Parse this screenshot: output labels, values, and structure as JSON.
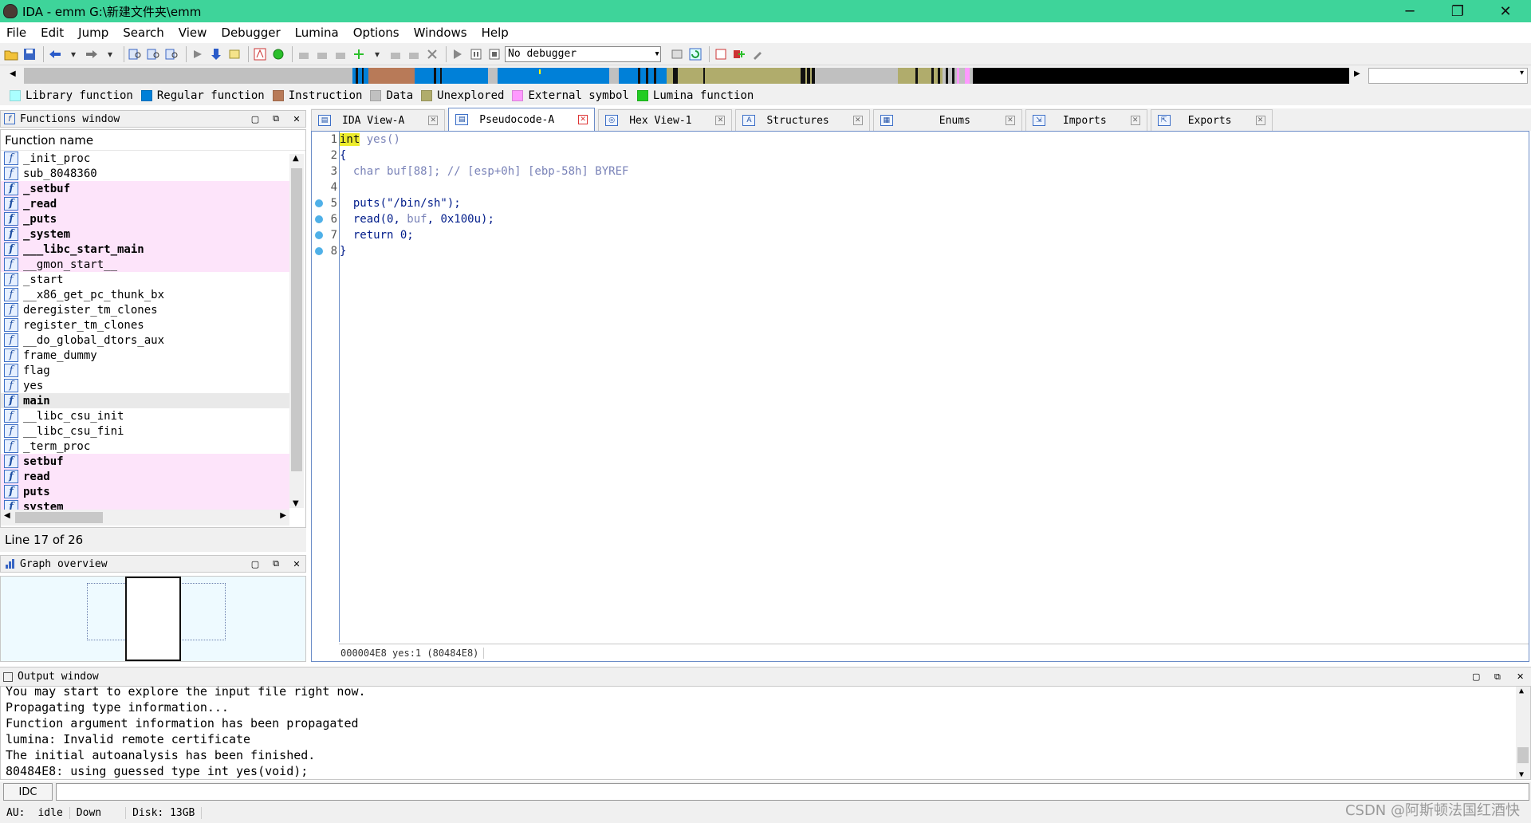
{
  "window": {
    "title": "IDA - emm G:\\新建文件夹\\emm",
    "controls": [
      "─",
      "❐",
      "✕"
    ]
  },
  "menu": [
    "File",
    "Edit",
    "Jump",
    "Search",
    "View",
    "Debugger",
    "Lumina",
    "Options",
    "Windows",
    "Help"
  ],
  "toolbar": {
    "debugger_select": "No debugger"
  },
  "legend": [
    {
      "label": "Library function",
      "color": "#aaffff"
    },
    {
      "label": "Regular function",
      "color": "#0080d8"
    },
    {
      "label": "Instruction",
      "color": "#b87a58"
    },
    {
      "label": "Data",
      "color": "#c0c0c0"
    },
    {
      "label": "Unexplored",
      "color": "#b0ac6c"
    },
    {
      "label": "External symbol",
      "color": "#ff99ff"
    },
    {
      "label": "Lumina function",
      "color": "#22cc22"
    }
  ],
  "functions_window": {
    "title": "Functions window",
    "column_header": "Function name",
    "items": [
      {
        "name": "_init_proc",
        "style": ""
      },
      {
        "name": "sub_8048360",
        "style": ""
      },
      {
        "name": "_setbuf",
        "style": "lib bold"
      },
      {
        "name": "_read",
        "style": "lib bold"
      },
      {
        "name": "_puts",
        "style": "lib bold"
      },
      {
        "name": "_system",
        "style": "lib bold"
      },
      {
        "name": "___libc_start_main",
        "style": "lib bold"
      },
      {
        "name": "__gmon_start__",
        "style": "lib"
      },
      {
        "name": "_start",
        "style": ""
      },
      {
        "name": "__x86_get_pc_thunk_bx",
        "style": ""
      },
      {
        "name": "deregister_tm_clones",
        "style": ""
      },
      {
        "name": "register_tm_clones",
        "style": ""
      },
      {
        "name": "__do_global_dtors_aux",
        "style": ""
      },
      {
        "name": "frame_dummy",
        "style": ""
      },
      {
        "name": "flag",
        "style": ""
      },
      {
        "name": "yes",
        "style": ""
      },
      {
        "name": "main",
        "style": "sel bold"
      },
      {
        "name": "__libc_csu_init",
        "style": ""
      },
      {
        "name": "__libc_csu_fini",
        "style": ""
      },
      {
        "name": "_term_proc",
        "style": ""
      },
      {
        "name": "setbuf",
        "style": "lib bold"
      },
      {
        "name": "read",
        "style": "lib bold"
      },
      {
        "name": "puts",
        "style": "lib bold"
      },
      {
        "name": "system",
        "style": "lib bold"
      }
    ],
    "status": "Line 17 of 26"
  },
  "graph_overview": {
    "title": "Graph overview"
  },
  "tabs": [
    {
      "label": "IDA View-A",
      "active": false,
      "icon": "ida-view-icon"
    },
    {
      "label": "Pseudocode-A",
      "active": true,
      "icon": "pseudocode-icon"
    },
    {
      "label": "Hex View-1",
      "active": false,
      "icon": "hex-view-icon"
    },
    {
      "label": "Structures",
      "active": false,
      "icon": "structures-icon"
    },
    {
      "label": "Enums",
      "active": false,
      "icon": "enums-icon"
    },
    {
      "label": "Imports",
      "active": false,
      "icon": "imports-icon"
    },
    {
      "label": "Exports",
      "active": false,
      "icon": "exports-icon"
    }
  ],
  "pseudocode": {
    "lines": [
      {
        "no": "1",
        "bp": false
      },
      {
        "no": "2",
        "bp": false
      },
      {
        "no": "3",
        "bp": false
      },
      {
        "no": "4",
        "bp": false
      },
      {
        "no": "5",
        "bp": true
      },
      {
        "no": "6",
        "bp": true
      },
      {
        "no": "7",
        "bp": true
      },
      {
        "no": "8",
        "bp": true
      }
    ],
    "code": {
      "l1_kw": "int",
      "l1_rest": " yes()",
      "l2": "{",
      "l3_a": "  char buf[88]; ",
      "l3_b": "// [esp+0h] [ebp-58h] BYREF",
      "l5": "  puts(\"/bin/sh\");",
      "l6_a": "  read(0, ",
      "l6_b": "buf",
      "l6_c": ", 0x100u);",
      "l7": "  return 0;",
      "l8": "}"
    },
    "status": "000004E8 yes:1 (80484E8)"
  },
  "output_window": {
    "title": "Output window",
    "lines": [
      "You may start to explore the input file right now.",
      "Propagating type information...",
      "Function argument information has been propagated",
      "lumina: Invalid remote certificate",
      "The initial autoanalysis has been finished.",
      "80484E8: using guessed type int yes(void);"
    ]
  },
  "command_bar": {
    "lang": "IDC"
  },
  "statusbar": {
    "au": "AU:",
    "state": "idle",
    "direction": "Down",
    "disk": "Disk: 13GB"
  },
  "watermark": "CSDN @阿斯顿法国红酒快"
}
